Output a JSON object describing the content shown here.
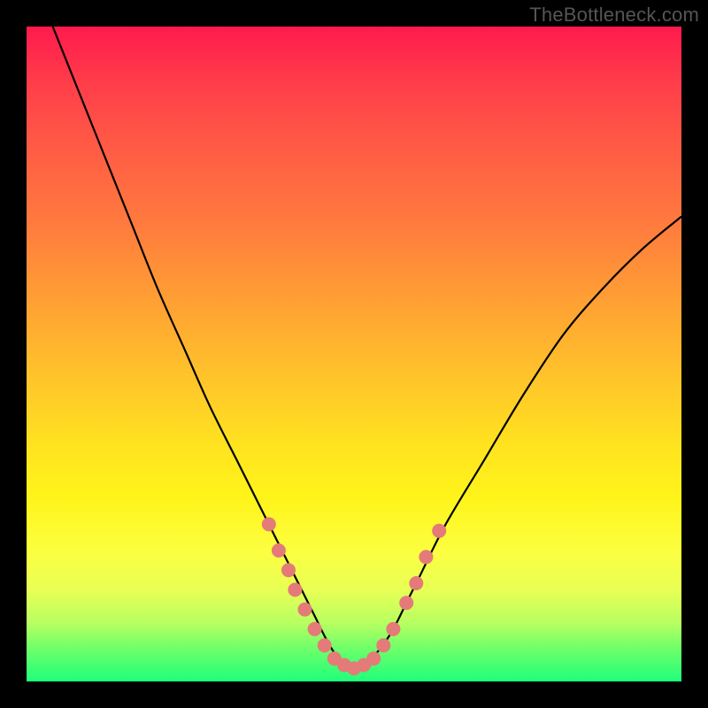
{
  "watermark": "TheBottleneck.com",
  "colors": {
    "frame": "#000000",
    "gradient_top": "#ff1a4d",
    "gradient_mid": "#ffe31f",
    "gradient_bottom": "#1fff7a",
    "curve": "#000000",
    "dots": "#e47b78"
  },
  "chart_data": {
    "type": "line",
    "title": "",
    "xlabel": "",
    "ylabel": "",
    "xlim": [
      0,
      100
    ],
    "ylim": [
      0,
      100
    ],
    "grid": false,
    "legend": false,
    "note": "Axes are unlabeled in the source image; x and y are normalized 0–100 percent of the plot area. y=100 is the top (red), y=0 is the bottom (green). Curve minimum near x≈49, y≈2.",
    "series": [
      {
        "name": "curve",
        "x": [
          4,
          8,
          12,
          16,
          20,
          24,
          28,
          32,
          36,
          38,
          40,
          42,
          44,
          46,
          48,
          50,
          52,
          54,
          56,
          58,
          60,
          64,
          70,
          76,
          82,
          88,
          94,
          100
        ],
        "y": [
          100,
          90,
          80,
          70,
          60,
          51,
          42,
          34,
          26,
          22,
          18,
          14,
          10,
          6,
          3,
          2,
          3,
          5,
          8,
          12,
          16,
          24,
          34,
          44,
          53,
          60,
          66,
          71
        ]
      }
    ],
    "markers": {
      "name": "dots",
      "note": "Salmon-colored sample points clustered near the valley of the curve.",
      "points": [
        {
          "x": 37,
          "y": 24
        },
        {
          "x": 38.5,
          "y": 20
        },
        {
          "x": 40,
          "y": 17
        },
        {
          "x": 41,
          "y": 14
        },
        {
          "x": 42.5,
          "y": 11
        },
        {
          "x": 44,
          "y": 8
        },
        {
          "x": 45.5,
          "y": 5.5
        },
        {
          "x": 47,
          "y": 3.5
        },
        {
          "x": 48.5,
          "y": 2.5
        },
        {
          "x": 50,
          "y": 2
        },
        {
          "x": 51.5,
          "y": 2.5
        },
        {
          "x": 53,
          "y": 3.5
        },
        {
          "x": 54.5,
          "y": 5.5
        },
        {
          "x": 56,
          "y": 8
        },
        {
          "x": 58,
          "y": 12
        },
        {
          "x": 59.5,
          "y": 15
        },
        {
          "x": 61,
          "y": 19
        },
        {
          "x": 63,
          "y": 23
        }
      ]
    }
  }
}
